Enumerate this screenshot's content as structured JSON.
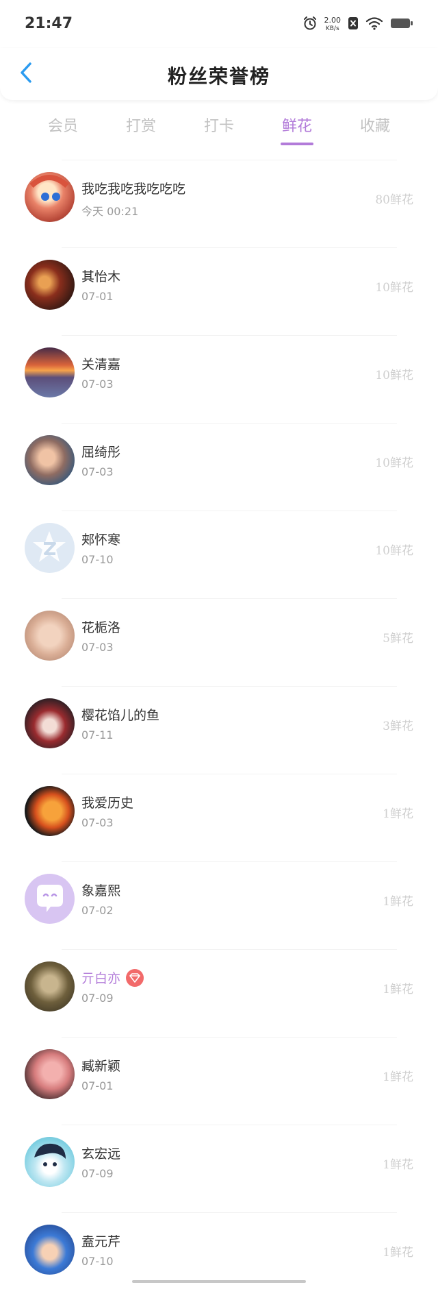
{
  "status_bar": {
    "time": "21:47",
    "net_speed_value": "2.00",
    "net_speed_unit": "KB/s",
    "icons": [
      "alarm-icon",
      "close-box-icon",
      "wifi-icon",
      "battery-icon"
    ]
  },
  "header": {
    "title": "粉丝荣誉榜",
    "back_icon": "chevron-left-icon"
  },
  "tabs": [
    {
      "label": "会员",
      "active": false
    },
    {
      "label": "打赏",
      "active": false
    },
    {
      "label": "打卡",
      "active": false
    },
    {
      "label": "鲜花",
      "active": true
    },
    {
      "label": "收藏",
      "active": false
    }
  ],
  "list": [
    {
      "name": "我吃我吃我吃吃吃",
      "date": "今天 00:21",
      "count": "80鲜花"
    },
    {
      "name": "其怡木",
      "date": "07-01",
      "count": "10鲜花"
    },
    {
      "name": "关清嘉",
      "date": "07-03",
      "count": "10鲜花"
    },
    {
      "name": "屈绮彤",
      "date": "07-03",
      "count": "10鲜花"
    },
    {
      "name": "郏怀寒",
      "date": "07-10",
      "count": "10鲜花"
    },
    {
      "name": "花栀洛",
      "date": "07-03",
      "count": "5鲜花"
    },
    {
      "name": "樱花馅儿的鱼",
      "date": "07-11",
      "count": "3鲜花"
    },
    {
      "name": "我爱历史",
      "date": "07-03",
      "count": "1鲜花"
    },
    {
      "name": "象嘉熙",
      "date": "07-02",
      "count": "1鲜花"
    },
    {
      "name": "亓白亦",
      "date": "07-09",
      "count": "1鲜花",
      "vip": true
    },
    {
      "name": "臧新颖",
      "date": "07-01",
      "count": "1鲜花"
    },
    {
      "name": "玄宏远",
      "date": "07-09",
      "count": "1鲜花"
    },
    {
      "name": "盍元芹",
      "date": "07-10",
      "count": "1鲜花"
    }
  ],
  "colors": {
    "accent": "#b27bd9",
    "tab_inactive": "#c2c2c2",
    "count": "#cfcfcf",
    "vip_badge": "#f26a6a"
  }
}
